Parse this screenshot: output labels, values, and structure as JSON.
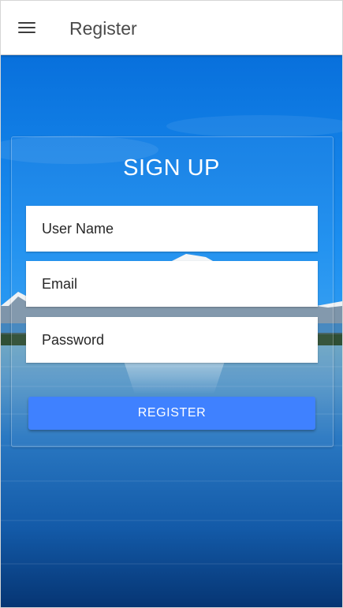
{
  "appbar": {
    "title": "Register",
    "menu_icon": "hamburger-menu-icon"
  },
  "form": {
    "heading": "SIGN UP",
    "fields": {
      "username": {
        "placeholder": "User Name",
        "value": ""
      },
      "email": {
        "placeholder": "Email",
        "value": ""
      },
      "password": {
        "placeholder": "Password",
        "value": ""
      }
    },
    "submit_label": "REGISTER"
  },
  "colors": {
    "appbar_bg": "#ffffff",
    "title_text": "#4a4a4a",
    "button_bg": "#3f81ff",
    "button_text": "#ffffff",
    "sky_top": "#0a7be3",
    "water_deep": "#0a3f7e"
  },
  "background": "sky-mountains-lake"
}
